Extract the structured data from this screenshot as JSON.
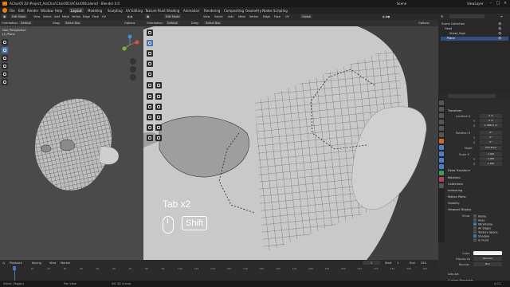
{
  "titlebar": {
    "title": "AChar05 [D:\\Project_Aa\\Char\\Char001\\AChar006.blend] - Blender 4.0",
    "scene": "Scene",
    "view_layer": "ViewLayer"
  },
  "menu": {
    "items": [
      "File",
      "Edit",
      "Render",
      "Window",
      "Help"
    ],
    "workspaces": [
      "Layout",
      "Modeling",
      "Sculpting",
      "UV Editing",
      "Texture Paint",
      "Shading",
      "Animation",
      "Rendering",
      "Compositing",
      "Geometry Nodes",
      "Scripting"
    ],
    "active_workspace": "Layout"
  },
  "viewport_left": {
    "mode": "Edit Mode",
    "menus": [
      "View",
      "Select",
      "Add",
      "Mesh",
      "Vertex",
      "Edge",
      "Face",
      "UV"
    ],
    "orientation_label": "Orientation:",
    "orientation": "Default",
    "drag_label": "Drag:",
    "drag": "Select Box",
    "view_name": "User Perspective",
    "object_name": "(1) Plane",
    "options": "Options"
  },
  "viewport_right": {
    "mode": "Edit Mode",
    "menus": [
      "View",
      "Select",
      "Add",
      "Mesh",
      "Vertex",
      "Edge",
      "Face",
      "UV"
    ],
    "global": "Global",
    "orientation_label": "Orientation:",
    "orientation": "Default",
    "drag_label": "Drag:",
    "drag": "Select Box",
    "options": "Options",
    "keys": {
      "tab": "Tab x2",
      "shift": "Shift"
    }
  },
  "outliner": {
    "title": "Scene Collection",
    "items": [
      "Scene Collection",
      "Head",
      "Sheet_High",
      "Plane"
    ]
  },
  "properties": {
    "transform": "Transform",
    "location_label": "Location X",
    "rotation_label": "Rotation X",
    "scale_label": "Scale X",
    "mode_label": "Mode",
    "mode": "XYZ Euler",
    "axes": [
      "Y",
      "Z"
    ],
    "location": [
      "0 m",
      "0 m",
      "1.36811 m"
    ],
    "rotation": [
      "0°",
      "0°",
      "0°"
    ],
    "scale": [
      "1.000",
      "1.000",
      "1.000"
    ],
    "delta": "Delta Transform",
    "panels": [
      "Relations",
      "Collections",
      "Instancing",
      "Motion Paths",
      "Visibility",
      "Viewport Display"
    ],
    "show_label": "Show",
    "show_items": [
      {
        "label": "Name",
        "checked": false
      },
      {
        "label": "Axes",
        "checked": false
      },
      {
        "label": "Wireframe",
        "checked": true
      },
      {
        "label": "All Edges",
        "checked": false
      },
      {
        "label": "Texture Space",
        "checked": false
      },
      {
        "label": "Shadow",
        "checked": true
      },
      {
        "label": "In Front",
        "checked": false
      }
    ],
    "color_label": "Color",
    "display_as_label": "Display As",
    "display_as": "Textured",
    "bounds_label": "Bounds",
    "bounds": "Box",
    "line_art": "Line Art",
    "custom_props": "Custom Properties"
  },
  "timeline": {
    "menus": [
      "Playback",
      "Keying",
      "View",
      "Marker"
    ],
    "frame": "1",
    "start_label": "Start",
    "start": "1",
    "end_label": "End",
    "end": "250",
    "ticks": [
      "0",
      "10",
      "20",
      "30",
      "40",
      "50",
      "60",
      "70",
      "80",
      "90",
      "100",
      "110",
      "120",
      "130",
      "140",
      "150",
      "160",
      "170",
      "180",
      "190",
      "200",
      "210",
      "220",
      "230",
      "240",
      "250"
    ]
  },
  "status": {
    "items": [
      "Select (Toggle)",
      "Pan View",
      "Set 3D Cursor"
    ],
    "version": "4.0.1"
  }
}
